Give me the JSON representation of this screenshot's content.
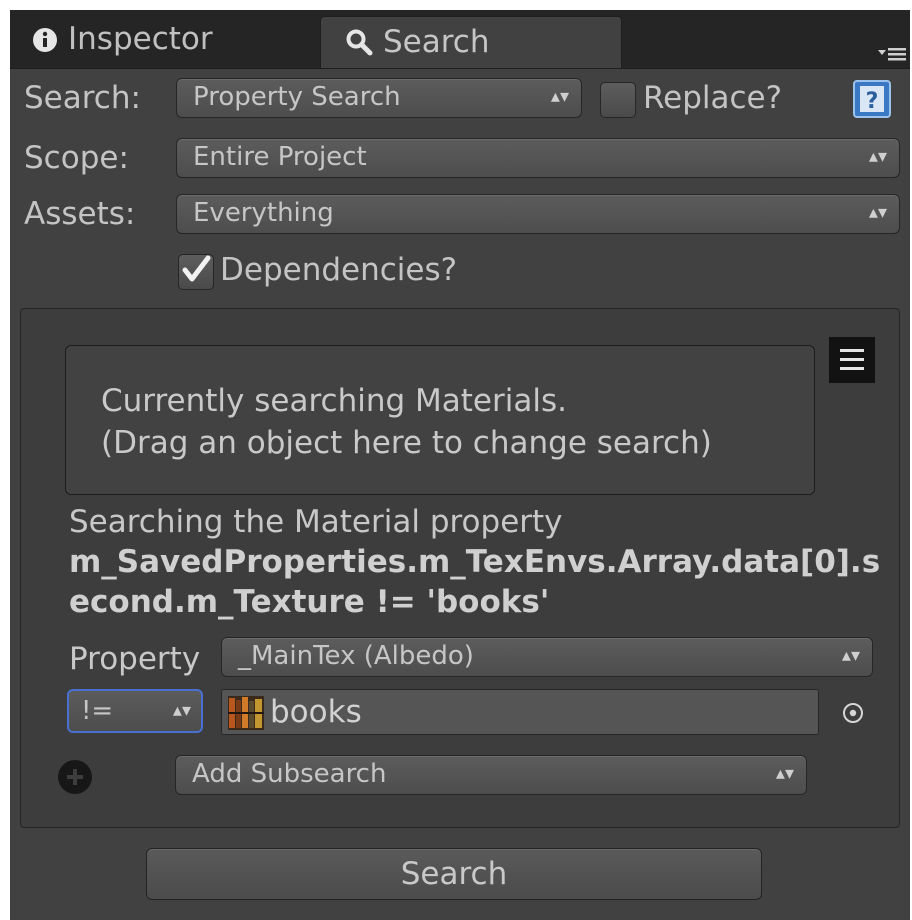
{
  "tabs": [
    {
      "label": "Inspector",
      "icon": "info-icon"
    },
    {
      "label": "Search",
      "icon": "magnifier-icon"
    }
  ],
  "form": {
    "search_label": "Search:",
    "search_value": "Property Search",
    "replace_label": "Replace?",
    "replace_checked": false,
    "scope_label": "Scope:",
    "scope_value": "Entire Project",
    "assets_label": "Assets:",
    "assets_value": "Everything",
    "dependencies_label": "Dependencies?",
    "dependencies_checked": true
  },
  "subsearch": {
    "drop_line1": "Currently searching Materials.",
    "drop_line2": "(Drag an object here to change search)",
    "desc_line1": "Searching the Material property",
    "desc_line2": "m_SavedProperties.m_TexEnvs.Array.data[0].s",
    "desc_line3": "econd.m_Texture != 'books'",
    "property_label": "Property",
    "property_value": "_MainTex (Albedo)",
    "operator_value": "!=",
    "object_value": "books",
    "add_subsearch_value": "Add Subsearch"
  },
  "search_button_label": "Search",
  "colors": {
    "panel_bg": "#414141",
    "tab_strip": "#252525",
    "focus_ring": "#4870d0"
  }
}
